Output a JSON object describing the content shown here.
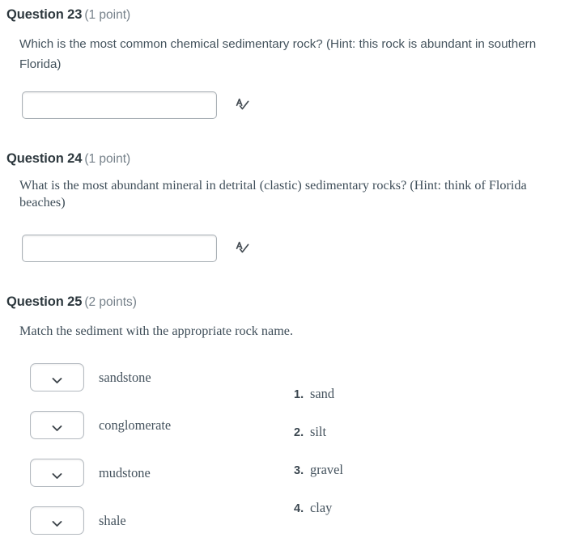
{
  "questions": [
    {
      "id": "q23",
      "title": "Question 23",
      "points": "(1 point)",
      "body": "Which is the most common chemical sedimentary rock? (Hint: this rock is abundant in southern Florida)",
      "answer_value": "",
      "answer_placeholder": "",
      "spellcheck_icon": "spellcheck-icon"
    },
    {
      "id": "q24",
      "title": "Question 24",
      "points": "(1 point)",
      "body": "What is the most abundant mineral in detrital (clastic) sedimentary rocks? (Hint: think of Florida beaches)",
      "answer_value": "",
      "answer_placeholder": "",
      "spellcheck_icon": "spellcheck-icon"
    },
    {
      "id": "q25",
      "title": "Question 25",
      "points": "(2 points)",
      "body": "Match the sediment with the appropriate rock name."
    }
  ],
  "matching": {
    "dropdown_icon": "chevron-down-icon",
    "selected_value": "",
    "items": [
      {
        "label": "sandstone",
        "value": ""
      },
      {
        "label": "conglomerate",
        "value": ""
      },
      {
        "label": "mudstone",
        "value": ""
      },
      {
        "label": "shale",
        "value": ""
      }
    ],
    "options": [
      {
        "number": "1.",
        "label": "sand"
      },
      {
        "number": "2.",
        "label": "silt"
      },
      {
        "number": "3.",
        "label": "gravel"
      },
      {
        "number": "4.",
        "label": "clay"
      }
    ]
  },
  "colors": {
    "background": "#ffffff",
    "heading": "#2d383e",
    "points": "#76818a",
    "body": "#44535d",
    "border": "#a9b0b6",
    "icon": "#454d54"
  }
}
